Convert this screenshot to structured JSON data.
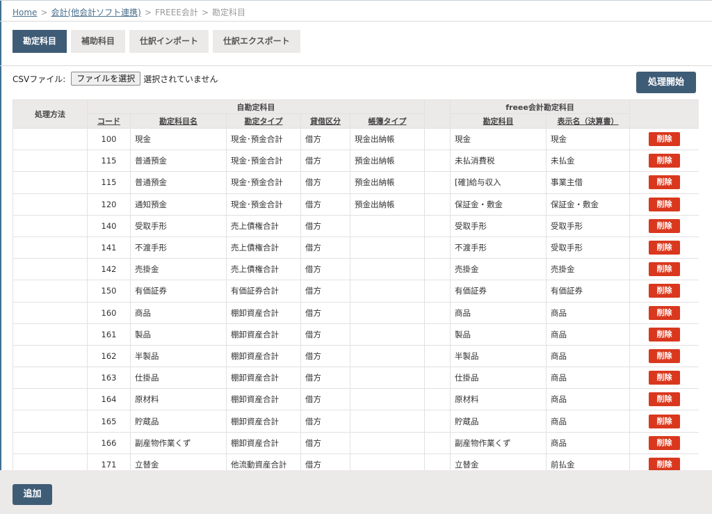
{
  "breadcrumb": {
    "home": "Home",
    "parent": "会計(他会計ソフト連携)",
    "section": "FREEE会計",
    "current": "勘定科目"
  },
  "tabs": [
    {
      "label": "勘定科目",
      "active": true
    },
    {
      "label": "補助科目",
      "active": false
    },
    {
      "label": "仕訳インポート",
      "active": false
    },
    {
      "label": "仕訳エクスポート",
      "active": false
    }
  ],
  "csv": {
    "label": "CSVファイル:",
    "button": "ファイルを選択",
    "status": "選択されていません"
  },
  "start_button": "処理開始",
  "add_button": "追加",
  "table": {
    "group_header_left": "処理方法",
    "group_header_own": "自勘定科目",
    "group_header_freee": "freee会計勘定科目",
    "columns": {
      "code": "コード",
      "name": "勘定科目名",
      "type": "勘定タイプ",
      "side": "貸借区分",
      "book": "帳簿タイプ",
      "freee_account": "勘定科目",
      "display": "表示名（決算書）"
    },
    "delete_label": "削除",
    "rows": [
      {
        "code": "100",
        "name": "現金",
        "type": "現金･預金合計",
        "side": "借方",
        "book": "現金出納帳",
        "freee": "現金",
        "display": "現金"
      },
      {
        "code": "115",
        "name": "普通預金",
        "type": "現金･預金合計",
        "side": "借方",
        "book": "預金出納帳",
        "freee": "未払消費税",
        "display": "未払金"
      },
      {
        "code": "115",
        "name": "普通預金",
        "type": "現金･預金合計",
        "side": "借方",
        "book": "預金出納帳",
        "freee": "[確]給与収入",
        "display": "事業主借"
      },
      {
        "code": "120",
        "name": "通知預金",
        "type": "現金･預金合計",
        "side": "借方",
        "book": "預金出納帳",
        "freee": "保証金・敷金",
        "display": "保証金・敷金"
      },
      {
        "code": "140",
        "name": "受取手形",
        "type": "売上債権合計",
        "side": "借方",
        "book": "",
        "freee": "受取手形",
        "display": "受取手形"
      },
      {
        "code": "141",
        "name": "不渡手形",
        "type": "売上債権合計",
        "side": "借方",
        "book": "",
        "freee": "不渡手形",
        "display": "受取手形"
      },
      {
        "code": "142",
        "name": "売掛金",
        "type": "売上債権合計",
        "side": "借方",
        "book": "",
        "freee": "売掛金",
        "display": "売掛金"
      },
      {
        "code": "150",
        "name": "有価証券",
        "type": "有価証券合計",
        "side": "借方",
        "book": "",
        "freee": "有価証券",
        "display": "有価証券"
      },
      {
        "code": "160",
        "name": "商品",
        "type": "棚卸資産合計",
        "side": "借方",
        "book": "",
        "freee": "商品",
        "display": "商品"
      },
      {
        "code": "161",
        "name": "製品",
        "type": "棚卸資産合計",
        "side": "借方",
        "book": "",
        "freee": "製品",
        "display": "商品"
      },
      {
        "code": "162",
        "name": "半製品",
        "type": "棚卸資産合計",
        "side": "借方",
        "book": "",
        "freee": "半製品",
        "display": "商品"
      },
      {
        "code": "163",
        "name": "仕掛品",
        "type": "棚卸資産合計",
        "side": "借方",
        "book": "",
        "freee": "仕掛品",
        "display": "商品"
      },
      {
        "code": "164",
        "name": "原材料",
        "type": "棚卸資産合計",
        "side": "借方",
        "book": "",
        "freee": "原材料",
        "display": "商品"
      },
      {
        "code": "165",
        "name": "貯蔵品",
        "type": "棚卸資産合計",
        "side": "借方",
        "book": "",
        "freee": "貯蔵品",
        "display": "商品"
      },
      {
        "code": "166",
        "name": "副産物作業くず",
        "type": "棚卸資産合計",
        "side": "借方",
        "book": "",
        "freee": "副産物作業くず",
        "display": "商品"
      },
      {
        "code": "171",
        "name": "立替金",
        "type": "他流動資産合計",
        "side": "借方",
        "book": "",
        "freee": "立替金",
        "display": "前払金"
      }
    ]
  }
}
